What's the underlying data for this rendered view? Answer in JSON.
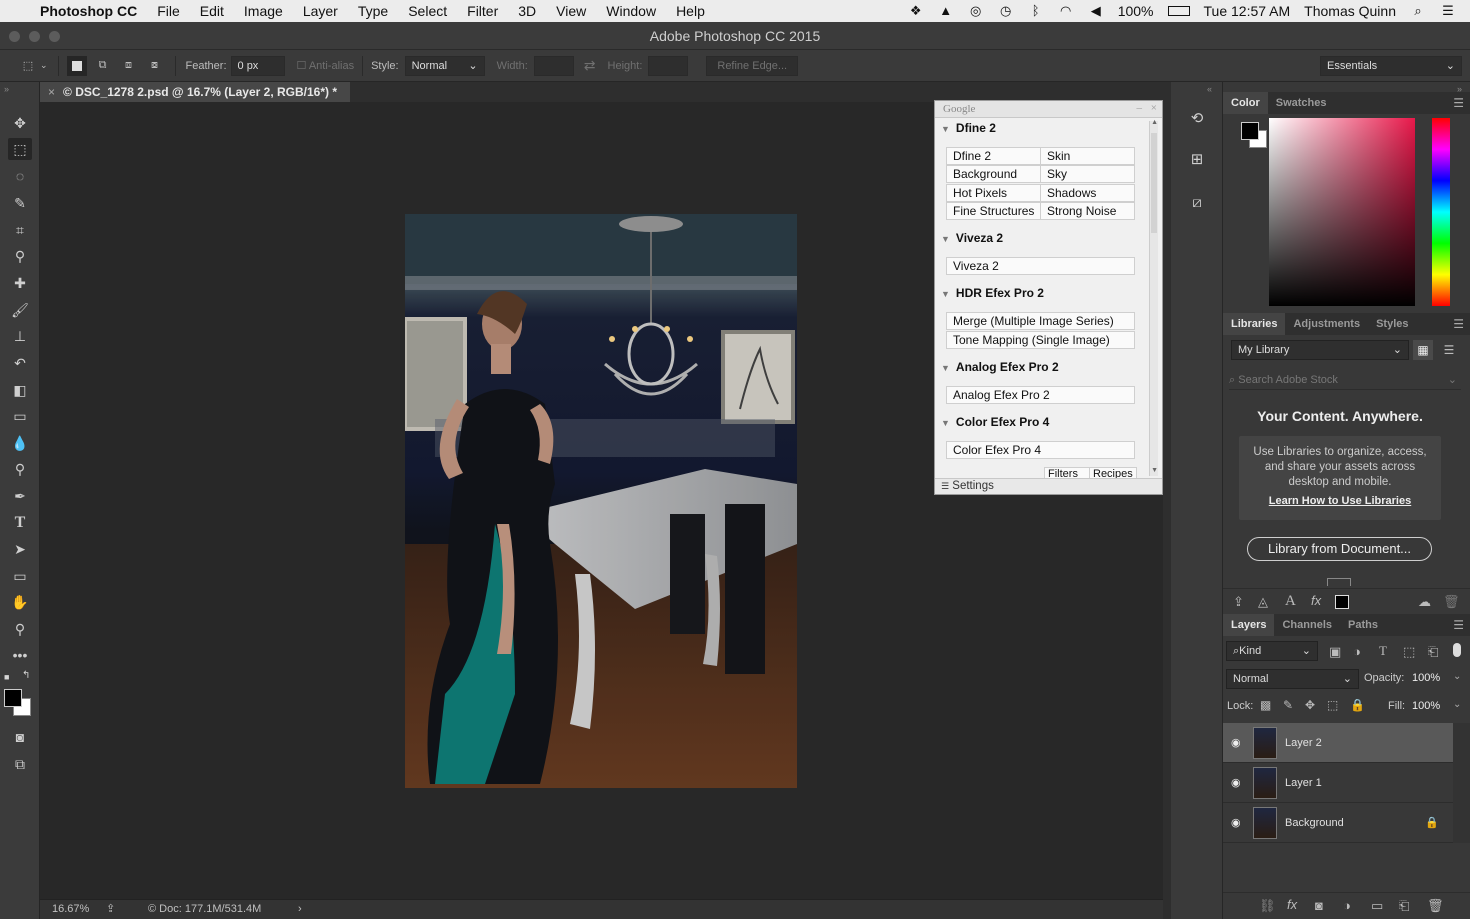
{
  "menubar": {
    "apple": "",
    "app": "Photoshop CC",
    "items": [
      "File",
      "Edit",
      "Image",
      "Layer",
      "Type",
      "Select",
      "Filter",
      "3D",
      "View",
      "Window",
      "Help"
    ],
    "battery": "100%",
    "clock": "Tue 12:57 AM",
    "user": "Thomas Quinn"
  },
  "window": {
    "title": "Adobe Photoshop CC 2015"
  },
  "options": {
    "feather_label": "Feather:",
    "feather_value": "0 px",
    "antialias_label": "Anti-alias",
    "style_label": "Style:",
    "style_value": "Normal",
    "width_label": "Width:",
    "height_label": "Height:",
    "refine_label": "Refine Edge...",
    "workspace": "Essentials"
  },
  "document": {
    "tab_title": "© DSC_1278 2.psd @ 16.7% (Layer 2, RGB/16*) *"
  },
  "status": {
    "zoom": "16.67%",
    "doc": "Doc: 177.1M/531.4M"
  },
  "google_panel": {
    "header": "Google",
    "sections": [
      {
        "title": "Dfine 2",
        "items": [
          "Dfine 2",
          "Skin",
          "Background",
          "Sky",
          "Hot Pixels",
          "Shadows",
          "Fine Structures",
          "Strong Noise"
        ]
      },
      {
        "title": "Viveza 2",
        "items": [
          "Viveza 2"
        ]
      },
      {
        "title": "HDR Efex Pro 2",
        "items": [
          "Merge (Multiple Image Series)",
          "Tone Mapping (Single Image)"
        ]
      },
      {
        "title": "Analog Efex Pro 2",
        "items": [
          "Analog Efex Pro 2"
        ]
      },
      {
        "title": "Color Efex Pro 4",
        "items": [
          "Color Efex Pro 4"
        ]
      }
    ],
    "bottom_tabs": [
      "Filters",
      "Recipes"
    ],
    "settings": "Settings"
  },
  "color_panel": {
    "tabs": [
      "Color",
      "Swatches"
    ]
  },
  "libraries": {
    "tabs": [
      "Libraries",
      "Adjustments",
      "Styles"
    ],
    "library": "My Library",
    "search_placeholder": "Search Adobe Stock",
    "headline": "Your Content. Anywhere.",
    "body": "Use Libraries to organize, access, and share your assets across desktop and mobile.",
    "link": "Learn How to Use Libraries",
    "button": "Library from Document..."
  },
  "layers": {
    "tabs": [
      "Layers",
      "Channels",
      "Paths"
    ],
    "kind": "Kind",
    "blend": "Normal",
    "opacity_label": "Opacity:",
    "opacity": "100%",
    "lock_label": "Lock:",
    "fill_label": "Fill:",
    "fill": "100%",
    "rows": [
      {
        "name": "Layer 2",
        "selected": true,
        "locked": false
      },
      {
        "name": "Layer 1",
        "selected": false,
        "locked": false
      },
      {
        "name": "Background",
        "selected": false,
        "locked": true
      }
    ]
  },
  "colors": {
    "ui_dark": "#282828",
    "panel": "#383838",
    "selected": "#595959",
    "accent_red": "#e8184a"
  }
}
